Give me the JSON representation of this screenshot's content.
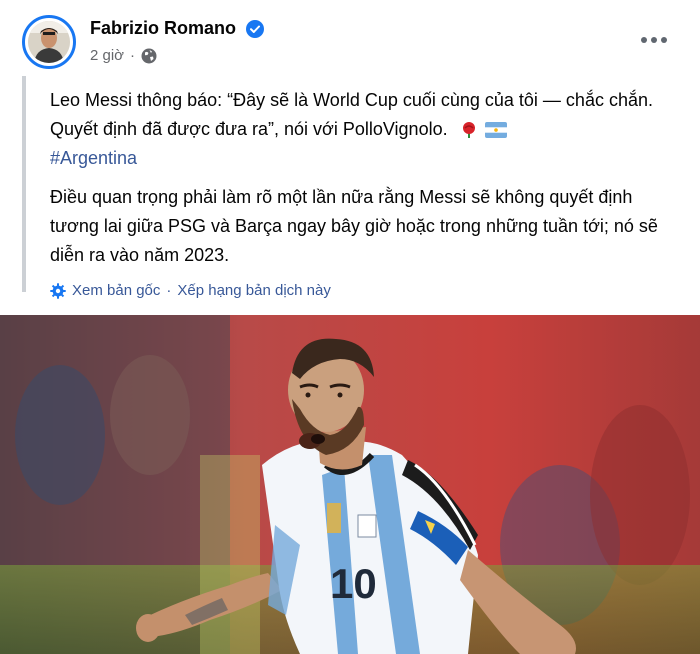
{
  "post": {
    "author": "Fabrizio Romano",
    "time": "2 giờ",
    "privacy_icon": "globe-icon",
    "verified_icon": "verified-badge-icon",
    "text_line1": "Leo Messi thông báo: “Đây sẽ là World Cup cuối cùng của tôi — chắc chắn. Quyết định đã được đưa ra”, nói với PolloVignolo.",
    "emoji": "🇦🇷",
    "hashtag": "#Argentina",
    "text_para2": "Điều quan trọng phải làm rõ một lần nữa rằng Messi sẽ không quyết định tương lai giữa PSG và Barça ngay bây giờ hoặc trong những tuần tới; nó sẽ diễn ra vào năm 2023.",
    "see_original": "Xem bản gốc",
    "separator": "·",
    "rate_translation": "Xếp hạng bản dịch này",
    "jersey_number": "10"
  },
  "colors": {
    "accent": "#1877f2",
    "link": "#385898",
    "meta_text": "#65676b",
    "quote_border": "#ccd0d5"
  }
}
